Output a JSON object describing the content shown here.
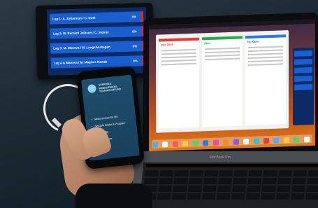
{
  "monitor": {
    "rows": [
      {
        "label": "Lag 1: A. Zetterman / C. Dufé",
        "pct": "0%"
      },
      {
        "label": "Lag 2: M. Berzard Jellison / C. Steiner",
        "pct": "0%"
      },
      {
        "label": "Lag 3: M. Maneva / M. Langshoskagen",
        "pct": "0%"
      },
      {
        "label": "Lag 4 & Maneva / M. Magnus Nawak",
        "pct": "0%"
      }
    ]
  },
  "laptop": {
    "columns": [
      {
        "title": "Blio 2018"
      },
      {
        "title": "Abio"
      },
      {
        "title": "Ny Karte"
      }
    ],
    "brand_label": "MacBook Pro"
  },
  "phone": {
    "brand": "SVERIGES INGENJÖRERS TEKNIKSAMFUND",
    "items": [
      "Nästa ämnen för Mii",
      "Senaste Bilder & Program",
      "Mål för Mig",
      "Bolagsdiplom"
    ]
  },
  "colors": {
    "monitor_bg": "#0c2a63",
    "row_blue": "#1a5fcf",
    "row_red": "#e02828",
    "phone_bg": "#1f4e6e",
    "desktop_orange": "#e07a18"
  }
}
